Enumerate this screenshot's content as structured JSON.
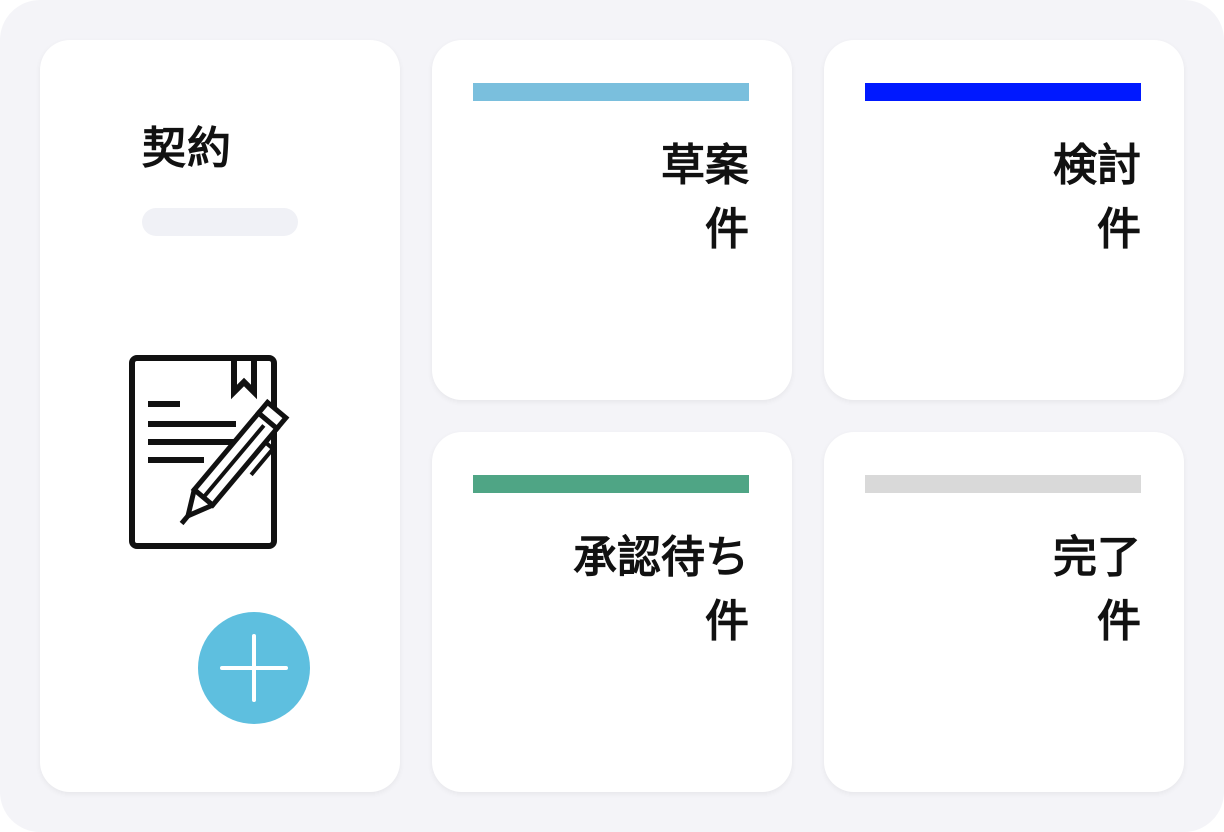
{
  "contract_card": {
    "title": "契約",
    "icon": "contract-document-pen-icon",
    "add_button_icon": "plus-icon",
    "accent_color": "#5ebfdf"
  },
  "status_cards": [
    {
      "label": "草案",
      "count_label": "件",
      "color": "#7abfdd"
    },
    {
      "label": "検討",
      "count_label": "件",
      "color": "#0019ff"
    },
    {
      "label": "承認待ち",
      "count_label": "件",
      "color": "#4fa585"
    },
    {
      "label": "完了",
      "count_label": "件",
      "color": "#d9d9d9"
    }
  ]
}
